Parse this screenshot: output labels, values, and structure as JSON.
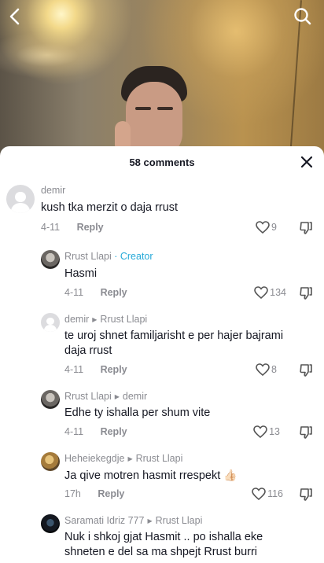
{
  "video": {
    "back_icon": "chevron-left-icon",
    "search_icon": "search-icon"
  },
  "sheet": {
    "count_label": "58 comments",
    "close_icon": "close-icon"
  },
  "comments": [
    {
      "user": "demir",
      "text": "kush tka merzit o daja rrust",
      "date": "4-11",
      "reply_label": "Reply",
      "likes": "9"
    },
    {
      "user": "Rrust Llapi",
      "badge": "· Creator",
      "text": "Hasmi",
      "date": "4-11",
      "reply_label": "Reply",
      "likes": "134"
    },
    {
      "user": "demir",
      "reply_to": "Rrust Llapi",
      "text_line1": "te uroj shnet familjarisht e per hajer bajrami",
      "text_line2": "daja rrust",
      "date": "4-11",
      "reply_label": "Reply",
      "likes": "8"
    },
    {
      "user": "Rrust Llapi",
      "reply_to": "demir",
      "text": "Edhe ty ishalla per shum vite",
      "date": "4-11",
      "reply_label": "Reply",
      "likes": "13"
    },
    {
      "user": "Heheiekegdje",
      "reply_to": "Rrust Llapi",
      "text": "Ja qive motren hasmit rrespekt",
      "emoji": "👍🏻",
      "date": "17h",
      "reply_label": "Reply",
      "likes": "116"
    },
    {
      "user": "Saramati Idriz 777",
      "reply_to": "Rrust Llapi",
      "text_line1": "Nuk i shkoj gjat Hasmit .. po ishalla eke",
      "text_line2": "shneten e del sa ma shpejt Rrust burri"
    }
  ]
}
